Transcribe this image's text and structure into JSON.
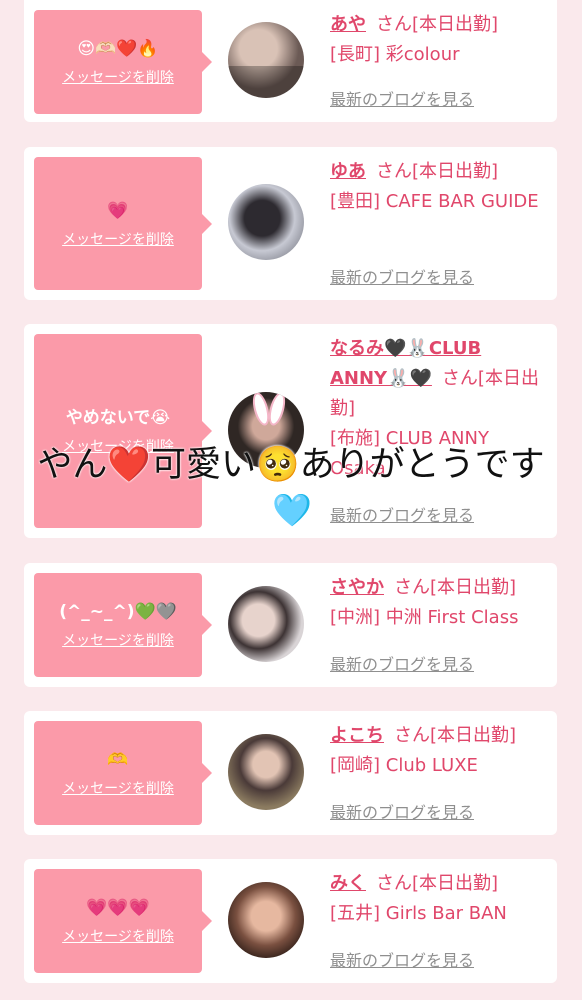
{
  "overlay": {
    "text": "やん❤️可愛い🥺ありがとうです",
    "sticker_heart": "🩵"
  },
  "cards": [
    {
      "message": "😍🫶🏻❤️🔥",
      "delete_label": "メッセージを削除",
      "name": "あや",
      "suffix": "さん[本日出勤]",
      "shop": "[長町] 彩colour",
      "blog_label": "最新のブログを見る",
      "avatar_color": "#6b5a55"
    },
    {
      "message": "💗",
      "delete_label": "メッセージを削除",
      "name": "ゆあ",
      "suffix": "さん[本日出勤]",
      "shop": "[豊田] CAFE BAR GUIDE",
      "blog_label": "最新のブログを見る",
      "avatar_color": "#7d7f8c"
    },
    {
      "message": "やめないで😭",
      "delete_label": "メッセージを削除",
      "name": "なるみ🖤🐰CLUB ANNY🐰🖤",
      "suffix": "さん[本日出勤]",
      "shop": "[布施] CLUB ANNY Osaka",
      "blog_label": "最新のブログを見る",
      "avatar_color": "#2f2724"
    },
    {
      "message": "(^_~_^)💚🩶",
      "delete_label": "メッセージを削除",
      "name": "さやか",
      "suffix": "さん[本日出勤]",
      "shop": "[中洲] 中洲 First Class",
      "blog_label": "最新のブログを見る",
      "avatar_color": "#bfb3b3"
    },
    {
      "message": "🫶",
      "delete_label": "メッセージを削除",
      "name": "よこち",
      "suffix": "さん[本日出勤]",
      "shop": "[岡崎] Club LUXE",
      "blog_label": "最新のブログを見る",
      "avatar_color": "#5a4a48"
    },
    {
      "message": "💗💗💗",
      "delete_label": "メッセージを削除",
      "name": "みく",
      "suffix": "さん[本日出勤]",
      "shop": "[五井] Girls Bar BAN",
      "blog_label": "最新のブログを見る",
      "avatar_color": "#7a5040"
    }
  ]
}
